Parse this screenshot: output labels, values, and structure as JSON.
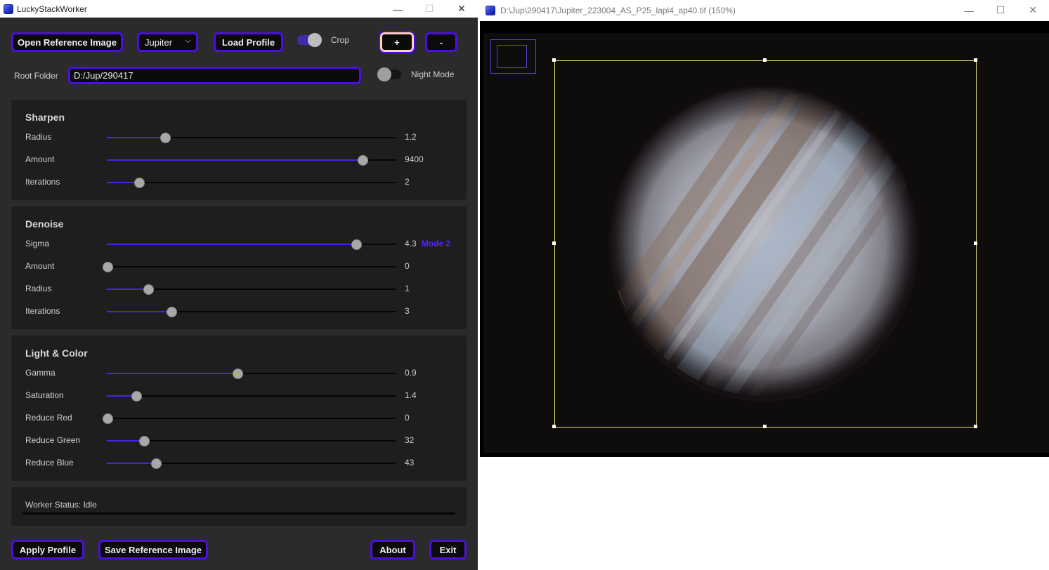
{
  "left_window": {
    "title": "LuckyStackWorker",
    "controls": {
      "minimize": "—",
      "maximize": "☐",
      "close": "✕"
    },
    "top_bar": {
      "open_reference_label": "Open Reference Image",
      "profile_select_value": "Jupiter",
      "load_profile_label": "Load Profile",
      "crop_label": "Crop",
      "crop_on": true,
      "zoom_in_label": "+",
      "zoom_out_label": "-",
      "root_folder_label": "Root Folder",
      "root_folder_value": "D:/Jup/290417",
      "night_mode_label": "Night Mode",
      "night_mode_on": false
    },
    "panels": {
      "sharpen": {
        "title": "Sharpen",
        "rows": [
          {
            "label": "Radius",
            "value": "1.2",
            "level": 0.2
          },
          {
            "label": "Amount",
            "value": "9400",
            "level": 0.88
          },
          {
            "label": "Iterations",
            "value": "2",
            "level": 0.11
          }
        ]
      },
      "denoise": {
        "title": "Denoise",
        "rows": [
          {
            "label": "Sigma",
            "value": "4.3",
            "level": 0.86,
            "extra": "Mode 2"
          },
          {
            "label": "Amount",
            "value": "0",
            "level": 0.0
          },
          {
            "label": "Radius",
            "value": "1",
            "level": 0.14
          },
          {
            "label": "Iterations",
            "value": "3",
            "level": 0.22
          }
        ]
      },
      "light_color": {
        "title": "Light & Color",
        "rows": [
          {
            "label": "Gamma",
            "value": "0.9",
            "level": 0.45
          },
          {
            "label": "Saturation",
            "value": "1.4",
            "level": 0.1
          },
          {
            "label": "Reduce Red",
            "value": "0",
            "level": 0.0
          },
          {
            "label": "Reduce Green",
            "value": "32",
            "level": 0.125
          },
          {
            "label": "Reduce Blue",
            "value": "43",
            "level": 0.168
          }
        ]
      }
    },
    "status": {
      "text": "Worker Status: Idle",
      "progress": 0
    },
    "bottom_bar": {
      "apply_profile_label": "Apply Profile",
      "save_reference_label": "Save Reference Image",
      "about_label": "About",
      "exit_label": "Exit"
    },
    "colors": {
      "accent": "#4a10e0",
      "panel_bg": "#1e1e1e",
      "window_bg": "#2b2b2b",
      "mode_label": "#5a22ff"
    }
  },
  "right_window": {
    "title": "D:\\Jup\\290417\\Jupiter_223004_AS_P25_lapl4_ap40.tif (150%)",
    "controls": {
      "minimize": "—",
      "maximize": "☐",
      "close": "✕"
    },
    "image": {
      "subject": "jupiter-planet",
      "crop_outline_color": "#e8e070"
    }
  }
}
